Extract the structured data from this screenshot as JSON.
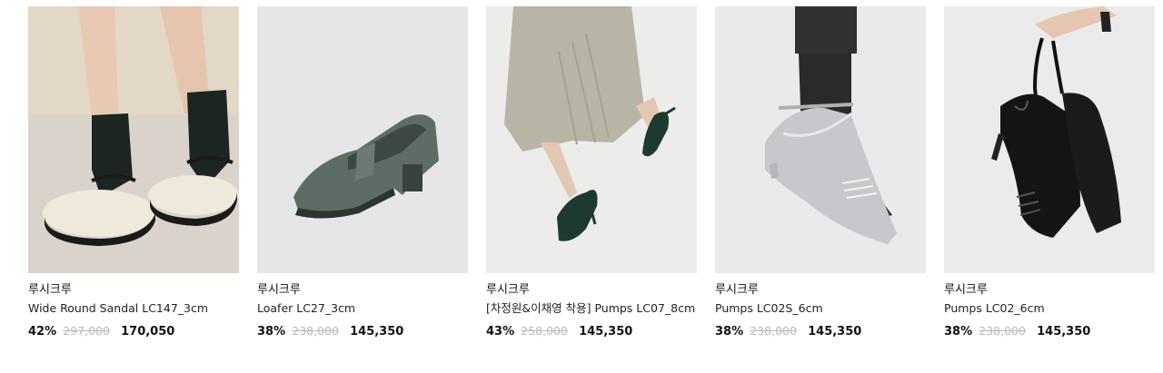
{
  "products": [
    {
      "brand": "루시크루",
      "name": "Wide Round Sandal LC147_3cm",
      "discount": "42%",
      "original_price": "297,000",
      "sale_price": "170,050",
      "image_label": "ivory mary-jane sandal with black socks"
    },
    {
      "brand": "루시크루",
      "name": "Loafer LC27_3cm",
      "discount": "38%",
      "original_price": "238,000",
      "sale_price": "145,350",
      "image_label": "grey-green square-toe loafer"
    },
    {
      "brand": "루시크루",
      "name": "[차정원&이채영 착용] Pumps LC07_8cm",
      "discount": "43%",
      "original_price": "258,000",
      "sale_price": "145,350",
      "image_label": "dark green pointed pumps worn with pleated skirt"
    },
    {
      "brand": "루시크루",
      "name": "Pumps LC02S_6cm",
      "discount": "38%",
      "original_price": "238,000",
      "sale_price": "145,350",
      "image_label": "silver strap pumps with sheer black tights"
    },
    {
      "brand": "루시크루",
      "name": "Pumps LC02_6cm",
      "discount": "38%",
      "original_price": "238,000",
      "sale_price": "145,350",
      "image_label": "black patent slingback pumps held in hand"
    }
  ]
}
